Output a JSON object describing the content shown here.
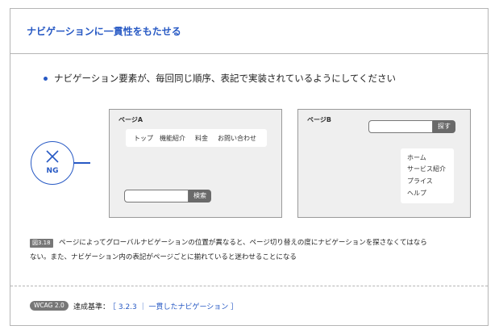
{
  "title": "ナビゲーションに一貫性をもたせる",
  "bullet": "ナビゲーション要素が、毎回同じ順序、表記で実装されているようにしてください",
  "badge": {
    "label": "NG"
  },
  "page_a": {
    "label": "ページA",
    "nav_items": [
      "トップ",
      "機能紹介",
      "料金",
      "お問い合わせ"
    ],
    "search_button": "検索"
  },
  "page_b": {
    "label": "ページB",
    "search_button": "探す",
    "nav_items": [
      "ホーム",
      "サービス紹介",
      "プライス",
      "ヘルプ"
    ]
  },
  "caption": {
    "tag": "図3.18",
    "line1": "ページによってグローバルナビゲーションの位置が異なると、ページ切り替えの度にナビゲーションを探さなくてはなら",
    "line2": "ない。また、ナビゲーション内の表記がページごとに揃れていると迷わせることになる"
  },
  "footer": {
    "tag": "WCAG 2.0",
    "label": "達成基準：",
    "link": "［ 3.2.3 ｜ 一貫したナビゲーション ］"
  },
  "colors": {
    "accent": "#2759c4",
    "panel": "#efefef",
    "button": "#6a6a6a"
  }
}
